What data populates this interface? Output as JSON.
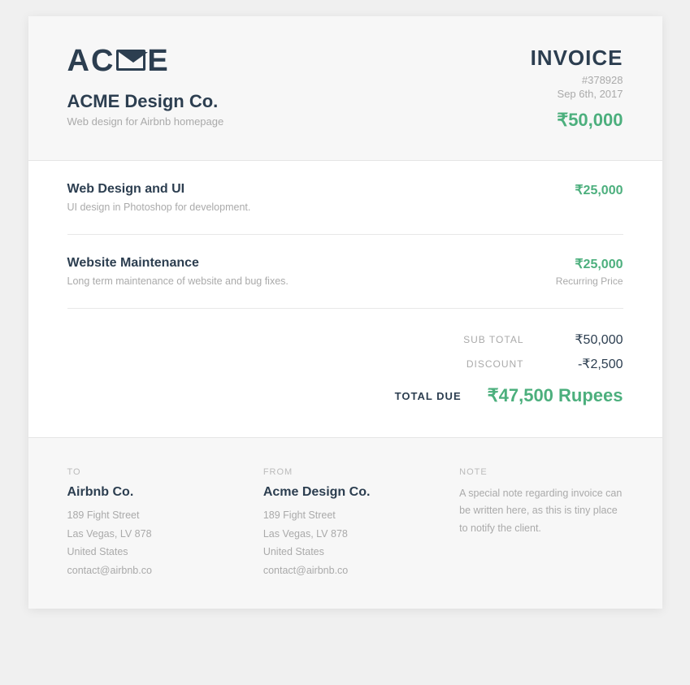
{
  "header": {
    "logo_text_left": "AC",
    "logo_text_right": "E",
    "company_name": "ACME Design Co.",
    "company_subtitle": "Web design for Airbnb homepage",
    "invoice_label": "INVOICE",
    "invoice_number": "#378928",
    "invoice_date": "Sep 6th, 2017",
    "invoice_total_header": "₹50,000"
  },
  "line_items": [
    {
      "title": "Web Design and UI",
      "description": "UI design in Photoshop for development.",
      "price": "₹25,000",
      "note": ""
    },
    {
      "title": "Website Maintenance",
      "description": "Long term maintenance of website and bug fixes.",
      "price": "₹25,000",
      "note": "Recurring Price"
    }
  ],
  "totals": {
    "subtotal_label": "SUB TOTAL",
    "subtotal_value": "₹50,000",
    "discount_label": "DISCOUNT",
    "discount_value": "-₹2,500",
    "total_due_label": "TOTAL DUE",
    "total_due_value": "₹47,500 Rupees"
  },
  "footer": {
    "to": {
      "section_label": "TO",
      "name": "Airbnb Co.",
      "address_line1": "189 Fight Street",
      "address_line2": "Las Vegas, LV 878",
      "address_line3": "United States",
      "address_line4": "contact@airbnb.co"
    },
    "from": {
      "section_label": "FROM",
      "name": "Acme Design Co.",
      "address_line1": "189 Fight Street",
      "address_line2": "Las Vegas, LV 878",
      "address_line3": "United States",
      "address_line4": "contact@airbnb.co"
    },
    "note": {
      "section_label": "NOTE",
      "text": "A special note regarding invoice can be written here, as this is tiny place to notify the client."
    }
  }
}
